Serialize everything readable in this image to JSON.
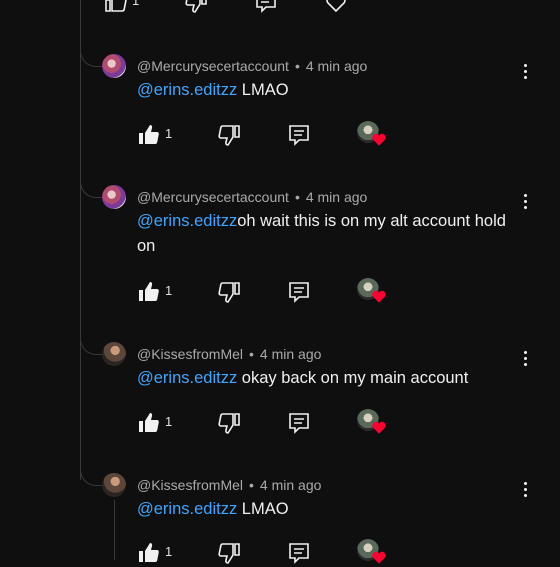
{
  "partial_top": {
    "like_count": "1"
  },
  "comments": [
    {
      "handle": "@Mercurysecertaccount",
      "time": "4 min ago",
      "mention": "@erins.editzz",
      "text": " LMAO",
      "likes": "1"
    },
    {
      "handle": "@Mercurysecertaccount",
      "time": "4 min ago",
      "mention": "@erins.editzz",
      "text": "oh wait this is on my alt account hold on",
      "likes": "1"
    },
    {
      "handle": "@KissesfromMel",
      "time": "4 min ago",
      "mention": "@erins.editzz",
      "text": " okay back on my main account",
      "likes": "1"
    },
    {
      "handle": "@KissesfromMel",
      "time": "4 min ago",
      "mention": "@erins.editzz",
      "text": " LMAO",
      "likes": "1"
    }
  ],
  "colors": {
    "background": "#0f0f0f",
    "mention": "#3ea6ff",
    "meta": "#aaaaaa",
    "heart": "#ff0033"
  },
  "icons": [
    "thumb-up-icon",
    "thumb-down-icon",
    "reply-icon",
    "heart-icon",
    "more-vert-icon"
  ]
}
